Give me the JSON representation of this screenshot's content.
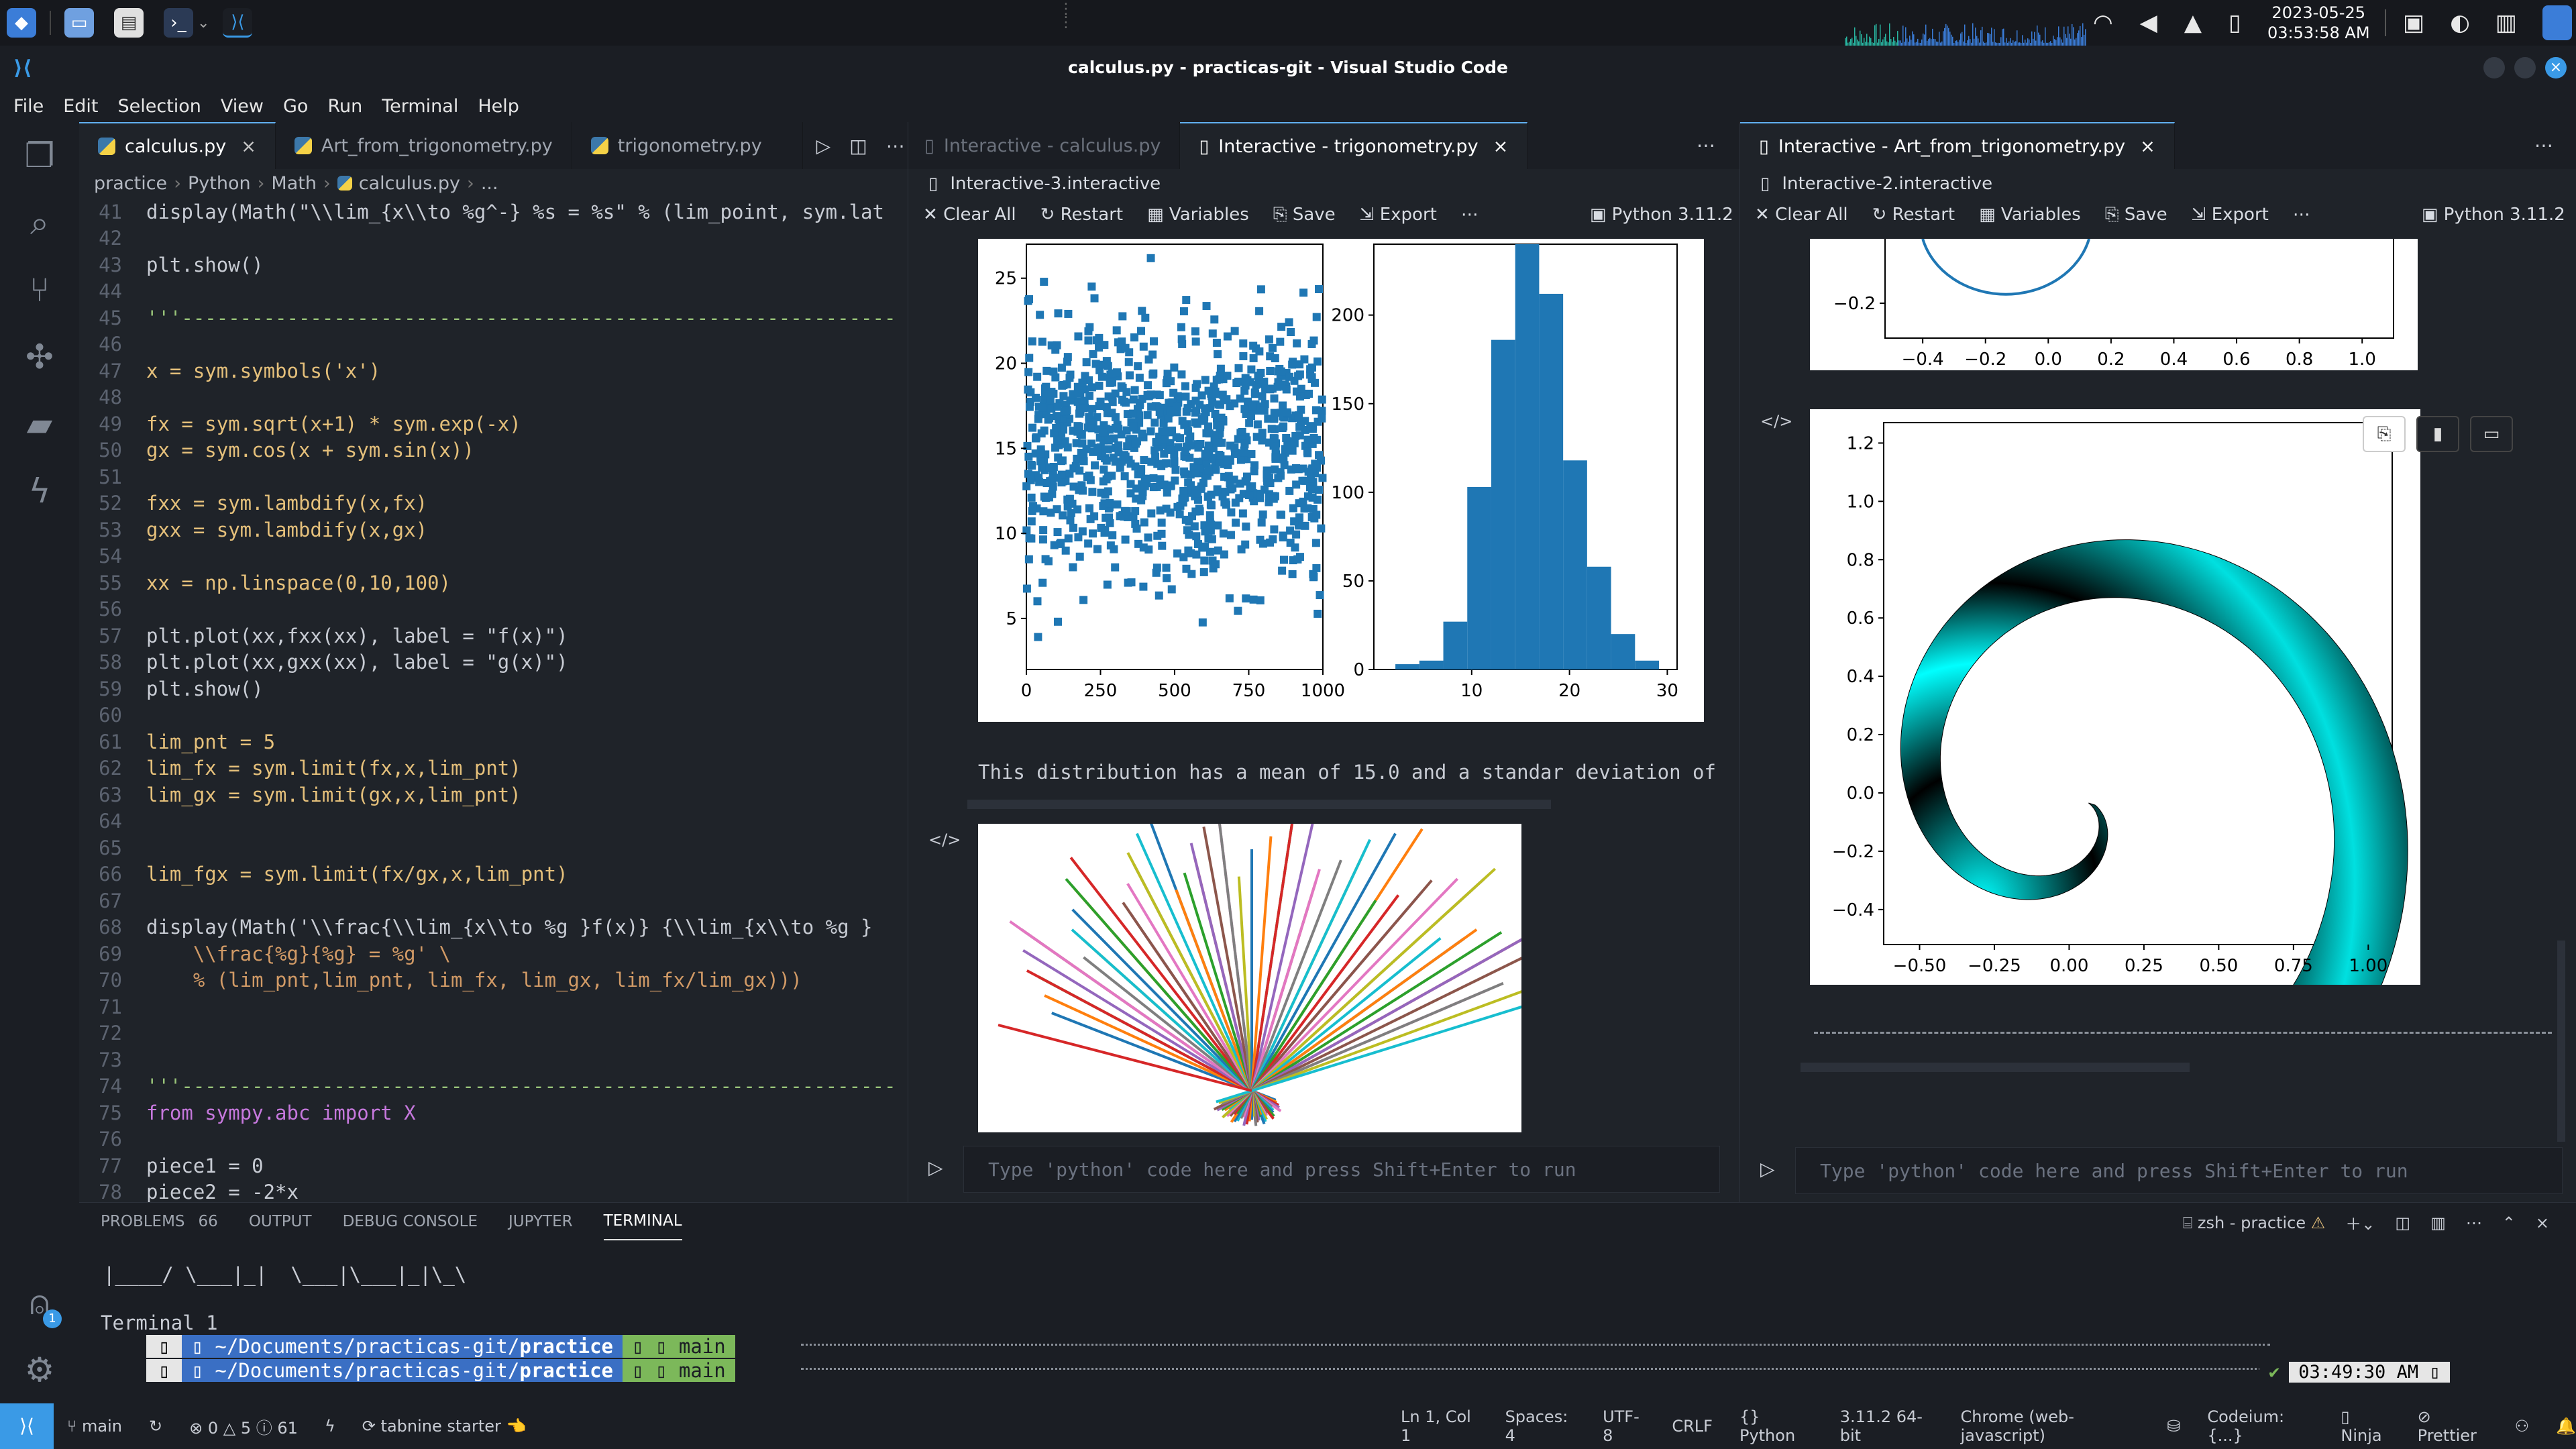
{
  "os_bar": {
    "date": "2023-05-25",
    "time": "03:53:58 AM"
  },
  "window": {
    "title": "calculus.py - practicas-git - Visual Studio Code"
  },
  "menu": [
    "File",
    "Edit",
    "Selection",
    "View",
    "Go",
    "Run",
    "Terminal",
    "Help"
  ],
  "editor": {
    "tabs": [
      {
        "label": "calculus.py",
        "active": true
      },
      {
        "label": "Art_from_trigonometry.py",
        "active": false
      },
      {
        "label": "trigonometry.py",
        "active": false
      }
    ],
    "breadcrumb": [
      "practice",
      "Python",
      "Math",
      "calculus.py",
      "..."
    ],
    "lines": [
      {
        "n": "41",
        "code": "display(Math(\"\\\\lim_{x\\\\to %g^-} %s = %s\" % (lim_point, sym.lat"
      },
      {
        "n": "42",
        "code": ""
      },
      {
        "n": "43",
        "code": "plt.show()"
      },
      {
        "n": "44",
        "code": ""
      },
      {
        "n": "45",
        "code": "'''-------------------------------------------------------------"
      },
      {
        "n": "46",
        "code": ""
      },
      {
        "n": "47",
        "code": "x = sym.symbols('x')"
      },
      {
        "n": "48",
        "code": ""
      },
      {
        "n": "49",
        "code": "fx = sym.sqrt(x+1) * sym.exp(-x)"
      },
      {
        "n": "50",
        "code": "gx = sym.cos(x + sym.sin(x))"
      },
      {
        "n": "51",
        "code": ""
      },
      {
        "n": "52",
        "code": "fxx = sym.lambdify(x,fx)"
      },
      {
        "n": "53",
        "code": "gxx = sym.lambdify(x,gx)"
      },
      {
        "n": "54",
        "code": ""
      },
      {
        "n": "55",
        "code": "xx = np.linspace(0,10,100)"
      },
      {
        "n": "56",
        "code": ""
      },
      {
        "n": "57",
        "code": "plt.plot(xx,fxx(xx), label = \"f(x)\")"
      },
      {
        "n": "58",
        "code": "plt.plot(xx,gxx(xx), label = \"g(x)\")"
      },
      {
        "n": "59",
        "code": "plt.show()"
      },
      {
        "n": "60",
        "code": ""
      },
      {
        "n": "61",
        "code": "lim_pnt = 5"
      },
      {
        "n": "62",
        "code": "lim_fx = sym.limit(fx,x,lim_pnt)"
      },
      {
        "n": "63",
        "code": "lim_gx = sym.limit(gx,x,lim_pnt)"
      },
      {
        "n": "64",
        "code": ""
      },
      {
        "n": "65",
        "code": ""
      },
      {
        "n": "66",
        "code": "lim_fgx = sym.limit(fx/gx,x,lim_pnt)"
      },
      {
        "n": "67",
        "code": ""
      },
      {
        "n": "68",
        "code": "display(Math('\\\\frac{\\\\lim_{x\\\\to %g }f(x)} {\\\\lim_{x\\\\to %g }"
      },
      {
        "n": "69",
        "code": "    \\\\frac{%g}{%g} = %g' \\"
      },
      {
        "n": "70",
        "code": "    % (lim_pnt,lim_pnt, lim_fx, lim_gx, lim_fx/lim_gx)))"
      },
      {
        "n": "71",
        "code": ""
      },
      {
        "n": "72",
        "code": ""
      },
      {
        "n": "73",
        "code": ""
      },
      {
        "n": "74",
        "code": "'''-------------------------------------------------------------"
      },
      {
        "n": "75",
        "code": "from sympy.abc import X"
      },
      {
        "n": "76",
        "code": ""
      },
      {
        "n": "77",
        "code": "piece1 = 0"
      },
      {
        "n": "78",
        "code": "piece2 = -2*x"
      }
    ]
  },
  "interactive_mid": {
    "tabs": [
      {
        "label": "Interactive - calculus.py",
        "active": false
      },
      {
        "label": "Interactive - trigonometry.py",
        "active": true
      }
    ],
    "file": "Interactive-3.interactive",
    "toolbar": {
      "clear": "Clear All",
      "restart": "Restart",
      "variables": "Variables",
      "save": "Save",
      "export": "Export",
      "kernel": "Python 3.11.2"
    },
    "output_text": "This distribution has a mean of 15.0 and a standar deviation of",
    "input_placeholder": "Type 'python' code here and press Shift+Enter to run"
  },
  "interactive_right": {
    "tabs": [
      {
        "label": "Interactive - Art_from_trigonometry.py",
        "active": true
      }
    ],
    "file": "Interactive-2.interactive",
    "toolbar": {
      "clear": "Clear All",
      "restart": "Restart",
      "variables": "Variables",
      "save": "Save",
      "export": "Export",
      "kernel": "Python 3.11.2"
    },
    "input_placeholder": "Type 'python' code here and press Shift+Enter to run"
  },
  "chart_data": [
    {
      "type": "scatter",
      "xticks": [
        "0",
        "250",
        "500",
        "750",
        "1000"
      ],
      "yticks": [
        "5",
        "10",
        "15",
        "20",
        "25"
      ],
      "xlim": [
        0,
        1000
      ],
      "ylim": [
        2,
        27
      ],
      "n_points": 1000,
      "color": "#1f77b4"
    },
    {
      "type": "bar",
      "xticks": [
        "10",
        "20",
        "30"
      ],
      "yticks": [
        "0",
        "50",
        "100",
        "150",
        "200"
      ],
      "bins": [
        1,
        3,
        5,
        7,
        9,
        11,
        13,
        15,
        17,
        19,
        21,
        23,
        25,
        27,
        29
      ],
      "values": [
        3,
        5,
        27,
        103,
        186,
        245,
        212,
        118,
        58,
        20,
        5
      ],
      "xlim": [
        0,
        31
      ],
      "ylim": [
        0,
        240
      ],
      "color": "#1f77b4"
    },
    {
      "type": "line",
      "description_lines": 60
    },
    {
      "type": "area",
      "xticks": [
        "−0.50",
        "−0.25",
        "0.00",
        "0.25",
        "0.50",
        "0.75",
        "1.00"
      ],
      "yticks": [
        "1.2",
        "1.0",
        "0.8",
        "0.6",
        "0.4",
        "0.2",
        "0.0",
        "−0.2",
        "−0.4"
      ],
      "xlim": [
        -0.62,
        1.08
      ],
      "ylim": [
        -0.52,
        1.27
      ],
      "colors": [
        "#000000",
        "#00ffff"
      ]
    },
    {
      "type": "line",
      "xticks": [
        "−0.4",
        "−0.2",
        "0.0",
        "0.2",
        "0.4",
        "0.6",
        "0.8",
        "1.0"
      ],
      "yticks": [
        "−0.2"
      ]
    }
  ],
  "panel": {
    "tabs": [
      "PROBLEMS",
      "OUTPUT",
      "DEBUG CONSOLE",
      "JUPYTER",
      "TERMINAL"
    ],
    "problems_count": "66",
    "terminal_label": "zsh - practice",
    "ascii": "|____/ \\___|_|  \\___|\\___|_|\\_\\",
    "terminal_title": "Terminal 1",
    "prompt_path": "~/Documents/practicas-git/",
    "prompt_dir": "practice",
    "prompt_branch": "main",
    "prompt_time": "03:49:30 AM"
  },
  "status": {
    "branch": "main",
    "errors": "0",
    "warnings": "5",
    "info": "61",
    "tabnine": "tabnine starter",
    "position": "Ln 1, Col 1",
    "spaces": "Spaces: 4",
    "encoding": "UTF-8",
    "eol": "CRLF",
    "language": "Python",
    "interpreter": "3.11.2 64-bit",
    "debug_config": "Chrome (web-javascript)",
    "codeium": "Codeium: {...}",
    "ninja": "Ninja",
    "prettier": "Prettier"
  }
}
